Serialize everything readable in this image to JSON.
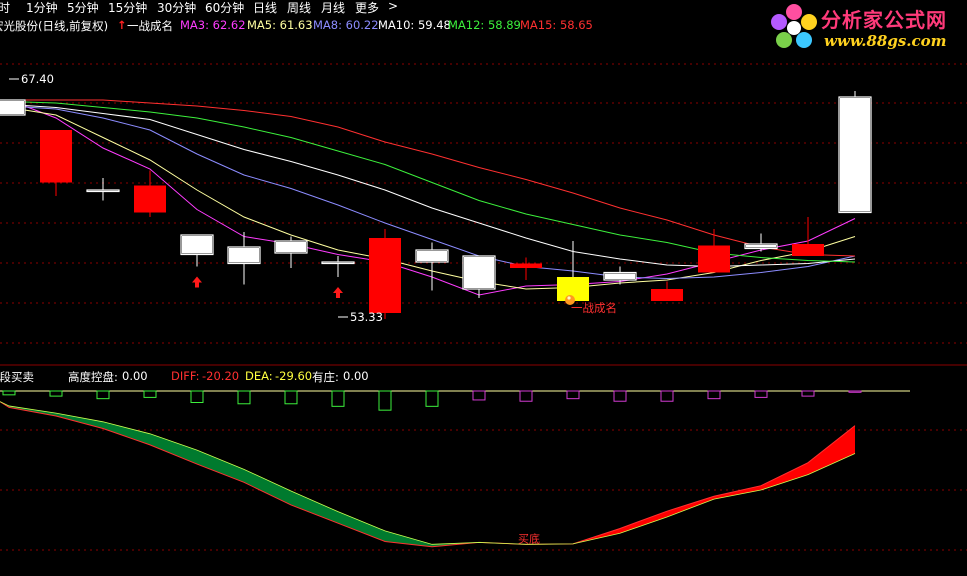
{
  "toolbar": {
    "items": [
      "分时",
      "1分钟",
      "5分钟",
      "15分钟",
      "30分钟",
      "60分钟",
      "日线",
      "周线",
      "月线",
      "更多",
      ">"
    ]
  },
  "legend": {
    "stock_title": "宏光股份(日线,前复权)",
    "signal_name": "一战成名",
    "ma": [
      {
        "label": "MA3:",
        "value": "62.62",
        "color": "#ff3cff"
      },
      {
        "label": "MA5:",
        "value": "61.63",
        "color": "#ffffa0"
      },
      {
        "label": "MA8:",
        "value": "60.22",
        "color": "#8c8cff"
      },
      {
        "label": "MA10:",
        "value": "59.48",
        "color": "#ffffff"
      },
      {
        "label": "MA12:",
        "value": "58.89",
        "color": "#3cf03c"
      },
      {
        "label": "MA15:",
        "value": "58.65",
        "color": "#ff3030"
      }
    ]
  },
  "indicator_legend": {
    "name": "波段买卖",
    "height_label": "高度控盘:",
    "height_value": "0.00",
    "diff_label": "DIFF:",
    "diff_value": "-20.20",
    "dea_label": "DEA:",
    "dea_value": "-29.60",
    "zhuang_label": "有庄:",
    "zhuang_value": "0.00"
  },
  "logo": {
    "name": "分析家公式网",
    "url_text": "www.88gs.com"
  },
  "colors": {
    "up": "#ff0000",
    "down": "#ffffff",
    "down_fill": "#000000",
    "grid": "#8b0000",
    "ribbon_down": "#007a2e",
    "ribbon_up": "#ff0000",
    "hist_neg": "#3cf03c",
    "hist_pos": "#d23cd2"
  },
  "chart_data": [
    {
      "type": "candlestick",
      "ylim": [
        49,
        70
      ],
      "x": [
        1,
        2,
        3,
        4,
        5,
        6,
        7,
        8,
        9,
        10,
        11,
        12,
        13,
        14,
        15,
        16,
        17,
        18,
        19
      ],
      "open": [
        66.0,
        60.5,
        60.0,
        58.5,
        57.0,
        56.2,
        56.6,
        55.2,
        51.8,
        56.0,
        55.6,
        54.8,
        54.2,
        54.5,
        52.6,
        54.5,
        56.4,
        55.6,
        66.2
      ],
      "close": [
        65.0,
        64.0,
        60.0,
        60.3,
        55.7,
        55.1,
        55.8,
        55.2,
        56.8,
        55.2,
        53.4,
        55.1,
        52.6,
        54.0,
        53.4,
        56.3,
        56.1,
        56.4,
        58.5
      ],
      "high": [
        66.0,
        64.0,
        60.8,
        61.3,
        56.6,
        57.2,
        56.9,
        55.6,
        57.4,
        56.5,
        55.5,
        55.5,
        56.6,
        54.9,
        53.9,
        57.4,
        57.1,
        58.2,
        66.6
      ],
      "low": [
        65.0,
        59.6,
        59.3,
        58.2,
        54.9,
        53.7,
        54.8,
        54.2,
        51.4,
        53.3,
        52.8,
        54.0,
        53.3,
        53.7,
        53.1,
        54.5,
        55.9,
        56.1,
        58.5
      ],
      "ma_series": [
        {
          "name": "MA3",
          "color": "#ff3cff",
          "values": [
            66.0,
            64.8,
            62.8,
            61.4,
            58.7,
            56.9,
            56.4,
            55.7,
            55.2,
            54.2,
            53.0,
            53.6,
            53.7,
            53.9,
            54.4,
            55.2,
            56.0,
            56.6,
            58.1
          ]
        },
        {
          "name": "MA5",
          "color": "#ffffa0",
          "values": [
            65.5,
            65.0,
            63.5,
            62.0,
            60.0,
            58.2,
            57.0,
            56.0,
            55.4,
            54.6,
            53.9,
            53.4,
            53.5,
            53.8,
            54.0,
            54.5,
            55.3,
            55.9,
            56.9
          ]
        },
        {
          "name": "MA8",
          "color": "#8c8cff",
          "values": [
            65.6,
            65.4,
            64.8,
            64.0,
            62.4,
            61.0,
            60.1,
            59.0,
            57.8,
            56.7,
            55.6,
            54.9,
            54.6,
            54.2,
            54.1,
            54.2,
            54.5,
            54.9,
            55.6
          ]
        },
        {
          "name": "MA10",
          "color": "#ffffff",
          "values": [
            65.7,
            65.5,
            65.1,
            64.7,
            63.7,
            62.7,
            61.9,
            61.0,
            60.0,
            58.8,
            57.8,
            56.8,
            55.9,
            55.4,
            55.0,
            54.9,
            55.0,
            55.1,
            55.4
          ]
        },
        {
          "name": "MA12",
          "color": "#3cf03c",
          "values": [
            65.9,
            65.8,
            65.5,
            65.2,
            64.8,
            64.2,
            63.5,
            62.6,
            61.7,
            60.5,
            59.3,
            58.4,
            57.7,
            57.0,
            56.5,
            55.8,
            55.5,
            55.3,
            55.2
          ]
        },
        {
          "name": "MA15",
          "color": "#ff3030",
          "values": [
            66.0,
            66.0,
            66.0,
            65.8,
            65.6,
            65.3,
            64.9,
            64.2,
            63.2,
            62.4,
            61.5,
            60.7,
            59.8,
            58.8,
            58.0,
            57.0,
            56.2,
            55.7,
            55.6
          ]
        }
      ],
      "annotations": [
        {
          "text": "67.40",
          "x": 1,
          "y": 67.4
        },
        {
          "text": "53.33",
          "x": 8,
          "y": 51.4
        },
        {
          "text": "一战成名",
          "x": 13,
          "y": 52.0
        }
      ],
      "signal_arrows_x": [
        5,
        8
      ],
      "signal_marker_x": 13
    },
    {
      "type": "bar",
      "title": "",
      "x": [
        1,
        2,
        3,
        4,
        5,
        6,
        7,
        8,
        9,
        10,
        11,
        12,
        13,
        14,
        15,
        16,
        17,
        18,
        19
      ],
      "values": [
        -0.3,
        -0.4,
        -0.6,
        -0.5,
        -0.9,
        -1.0,
        -1.0,
        -1.2,
        -1.5,
        -1.2,
        -0.7,
        -0.8,
        -0.6,
        -0.8,
        -0.8,
        -0.6,
        -0.5,
        -0.4,
        -0.1
      ],
      "ylim": [
        -1.8,
        0
      ]
    },
    {
      "type": "area",
      "ylim": [
        -34,
        2
      ],
      "x": [
        0,
        1,
        2,
        3,
        4,
        5,
        6,
        7,
        8,
        9,
        10,
        11,
        12,
        13,
        14,
        15,
        16,
        17,
        18,
        19
      ],
      "diff": [
        0,
        -1.2,
        -3.0,
        -5.6,
        -9.0,
        -13.0,
        -16.8,
        -21.5,
        -25.3,
        -29.1,
        -30.2,
        -29.3,
        -29.7,
        -29.6,
        -26.4,
        -22.8,
        -19.7,
        -17.5,
        -12.7,
        -5.0
      ],
      "dea": [
        0,
        -0.9,
        -2.4,
        -4.2,
        -6.7,
        -10.1,
        -14.1,
        -18.6,
        -22.9,
        -26.9,
        -29.7,
        -29.3,
        -29.7,
        -29.6,
        -27.4,
        -24.0,
        -20.3,
        -18.4,
        -15.2,
        -10.8
      ],
      "annotation": {
        "text": "买底",
        "x": 12
      }
    }
  ]
}
